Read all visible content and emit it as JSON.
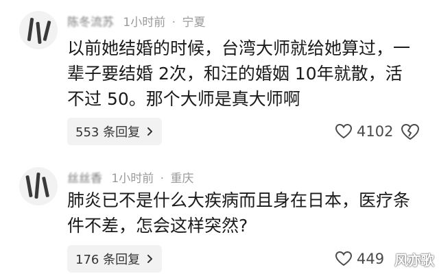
{
  "comments": [
    {
      "username": "陈冬流苏",
      "time": "1小时前",
      "location": "宁夏",
      "lines": [
        "以前她结婚的时候，台湾大师就给她算过，一",
        "辈子要结婚 2次，和汪的婚姻 10年就散，活",
        "不过 50。那个大师是真大师啊"
      ],
      "replies_label": "553 条回复",
      "likes": "4102",
      "like_icon": "heart-outline-icon",
      "dislike_icon": "broken-heart-icon"
    },
    {
      "username": "丝丝香",
      "time": "1小时前",
      "location": "重庆",
      "lines": [
        "肺炎已不是什么大疾病而且身在日本，医疗条",
        "件不差，怎会这样突然?"
      ],
      "replies_label": "176 条回复",
      "likes": "449",
      "like_icon": "heart-outline-icon"
    }
  ],
  "watermark": "风亦歌",
  "colors": {
    "meta_text": "#9a9a9a",
    "reply_bg": "#f2f2f2",
    "body_text": "#1a1a1a"
  }
}
